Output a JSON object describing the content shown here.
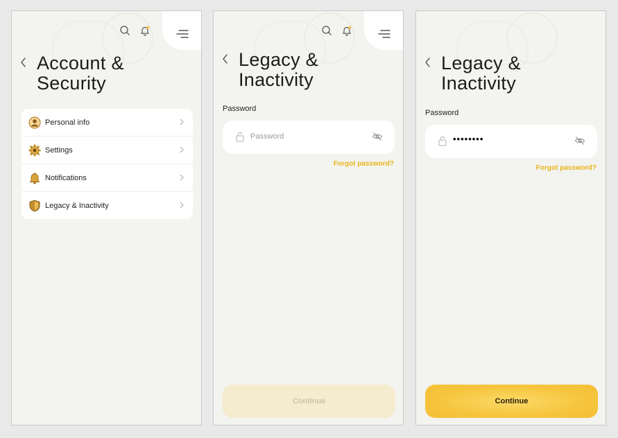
{
  "screens": {
    "account": {
      "title_line1": "Account &",
      "title_line2": "Security",
      "items": [
        {
          "label": "Personal info",
          "icon": "person-icon"
        },
        {
          "label": "Settings",
          "icon": "gear-icon"
        },
        {
          "label": "Notifications",
          "icon": "bell-icon"
        },
        {
          "label": "Legacy & Inactivity",
          "icon": "shield-icon"
        }
      ]
    },
    "legacy_empty": {
      "title_line1": "Legacy &",
      "title_line2": "Inactivity",
      "password_label": "Password",
      "password_placeholder": "Password",
      "forgot": "Forgot password?",
      "continue": "Continue"
    },
    "legacy_filled": {
      "title_line1": "Legacy &",
      "title_line2": "Inactivity",
      "password_label": "Password",
      "password_value": "••••••••",
      "forgot": "Forgot password?",
      "continue": "Continue"
    }
  },
  "colors": {
    "accent": "#f5c43d",
    "link": "#e8b51a",
    "background": "#f3f3ef",
    "notification_dot": "#f5c43d"
  }
}
